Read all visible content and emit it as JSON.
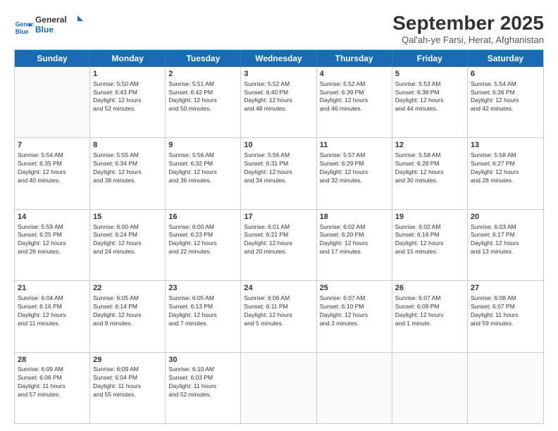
{
  "logo": {
    "line1": "General",
    "line2": "Blue"
  },
  "title": "September 2025",
  "subtitle": "Qal'ah-ye Farsi, Herat, Afghanistan",
  "header_days": [
    "Sunday",
    "Monday",
    "Tuesday",
    "Wednesday",
    "Thursday",
    "Friday",
    "Saturday"
  ],
  "weeks": [
    [
      {
        "day": "",
        "info": ""
      },
      {
        "day": "1",
        "info": "Sunrise: 5:50 AM\nSunset: 6:43 PM\nDaylight: 12 hours\nand 52 minutes."
      },
      {
        "day": "2",
        "info": "Sunrise: 5:51 AM\nSunset: 6:42 PM\nDaylight: 12 hours\nand 50 minutes."
      },
      {
        "day": "3",
        "info": "Sunrise: 5:52 AM\nSunset: 6:40 PM\nDaylight: 12 hours\nand 48 minutes."
      },
      {
        "day": "4",
        "info": "Sunrise: 5:52 AM\nSunset: 6:39 PM\nDaylight: 12 hours\nand 46 minutes."
      },
      {
        "day": "5",
        "info": "Sunrise: 5:53 AM\nSunset: 6:38 PM\nDaylight: 12 hours\nand 44 minutes."
      },
      {
        "day": "6",
        "info": "Sunrise: 5:54 AM\nSunset: 6:36 PM\nDaylight: 12 hours\nand 42 minutes."
      }
    ],
    [
      {
        "day": "7",
        "info": "Sunrise: 5:54 AM\nSunset: 6:35 PM\nDaylight: 12 hours\nand 40 minutes."
      },
      {
        "day": "8",
        "info": "Sunrise: 5:55 AM\nSunset: 6:34 PM\nDaylight: 12 hours\nand 38 minutes."
      },
      {
        "day": "9",
        "info": "Sunrise: 5:56 AM\nSunset: 6:32 PM\nDaylight: 12 hours\nand 36 minutes."
      },
      {
        "day": "10",
        "info": "Sunrise: 5:56 AM\nSunset: 6:31 PM\nDaylight: 12 hours\nand 34 minutes."
      },
      {
        "day": "11",
        "info": "Sunrise: 5:57 AM\nSunset: 6:29 PM\nDaylight: 12 hours\nand 32 minutes."
      },
      {
        "day": "12",
        "info": "Sunrise: 5:58 AM\nSunset: 6:28 PM\nDaylight: 12 hours\nand 30 minutes."
      },
      {
        "day": "13",
        "info": "Sunrise: 5:58 AM\nSunset: 6:27 PM\nDaylight: 12 hours\nand 28 minutes."
      }
    ],
    [
      {
        "day": "14",
        "info": "Sunrise: 5:59 AM\nSunset: 6:25 PM\nDaylight: 12 hours\nand 26 minutes."
      },
      {
        "day": "15",
        "info": "Sunrise: 6:00 AM\nSunset: 6:24 PM\nDaylight: 12 hours\nand 24 minutes."
      },
      {
        "day": "16",
        "info": "Sunrise: 6:00 AM\nSunset: 6:23 PM\nDaylight: 12 hours\nand 22 minutes."
      },
      {
        "day": "17",
        "info": "Sunrise: 6:01 AM\nSunset: 6:21 PM\nDaylight: 12 hours\nand 20 minutes."
      },
      {
        "day": "18",
        "info": "Sunrise: 6:02 AM\nSunset: 6:20 PM\nDaylight: 12 hours\nand 17 minutes."
      },
      {
        "day": "19",
        "info": "Sunrise: 6:02 AM\nSunset: 6:18 PM\nDaylight: 12 hours\nand 15 minutes."
      },
      {
        "day": "20",
        "info": "Sunrise: 6:03 AM\nSunset: 6:17 PM\nDaylight: 12 hours\nand 13 minutes."
      }
    ],
    [
      {
        "day": "21",
        "info": "Sunrise: 6:04 AM\nSunset: 6:16 PM\nDaylight: 12 hours\nand 11 minutes."
      },
      {
        "day": "22",
        "info": "Sunrise: 6:05 AM\nSunset: 6:14 PM\nDaylight: 12 hours\nand 9 minutes."
      },
      {
        "day": "23",
        "info": "Sunrise: 6:05 AM\nSunset: 6:13 PM\nDaylight: 12 hours\nand 7 minutes."
      },
      {
        "day": "24",
        "info": "Sunrise: 6:06 AM\nSunset: 6:11 PM\nDaylight: 12 hours\nand 5 minutes."
      },
      {
        "day": "25",
        "info": "Sunrise: 6:07 AM\nSunset: 6:10 PM\nDaylight: 12 hours\nand 3 minutes."
      },
      {
        "day": "26",
        "info": "Sunrise: 6:07 AM\nSunset: 6:09 PM\nDaylight: 12 hours\nand 1 minute."
      },
      {
        "day": "27",
        "info": "Sunrise: 6:08 AM\nSunset: 6:07 PM\nDaylight: 11 hours\nand 59 minutes."
      }
    ],
    [
      {
        "day": "28",
        "info": "Sunrise: 6:09 AM\nSunset: 6:06 PM\nDaylight: 11 hours\nand 57 minutes."
      },
      {
        "day": "29",
        "info": "Sunrise: 6:09 AM\nSunset: 6:04 PM\nDaylight: 11 hours\nand 55 minutes."
      },
      {
        "day": "30",
        "info": "Sunrise: 6:10 AM\nSunset: 6:03 PM\nDaylight: 11 hours\nand 52 minutes."
      },
      {
        "day": "",
        "info": ""
      },
      {
        "day": "",
        "info": ""
      },
      {
        "day": "",
        "info": ""
      },
      {
        "day": "",
        "info": ""
      }
    ]
  ]
}
